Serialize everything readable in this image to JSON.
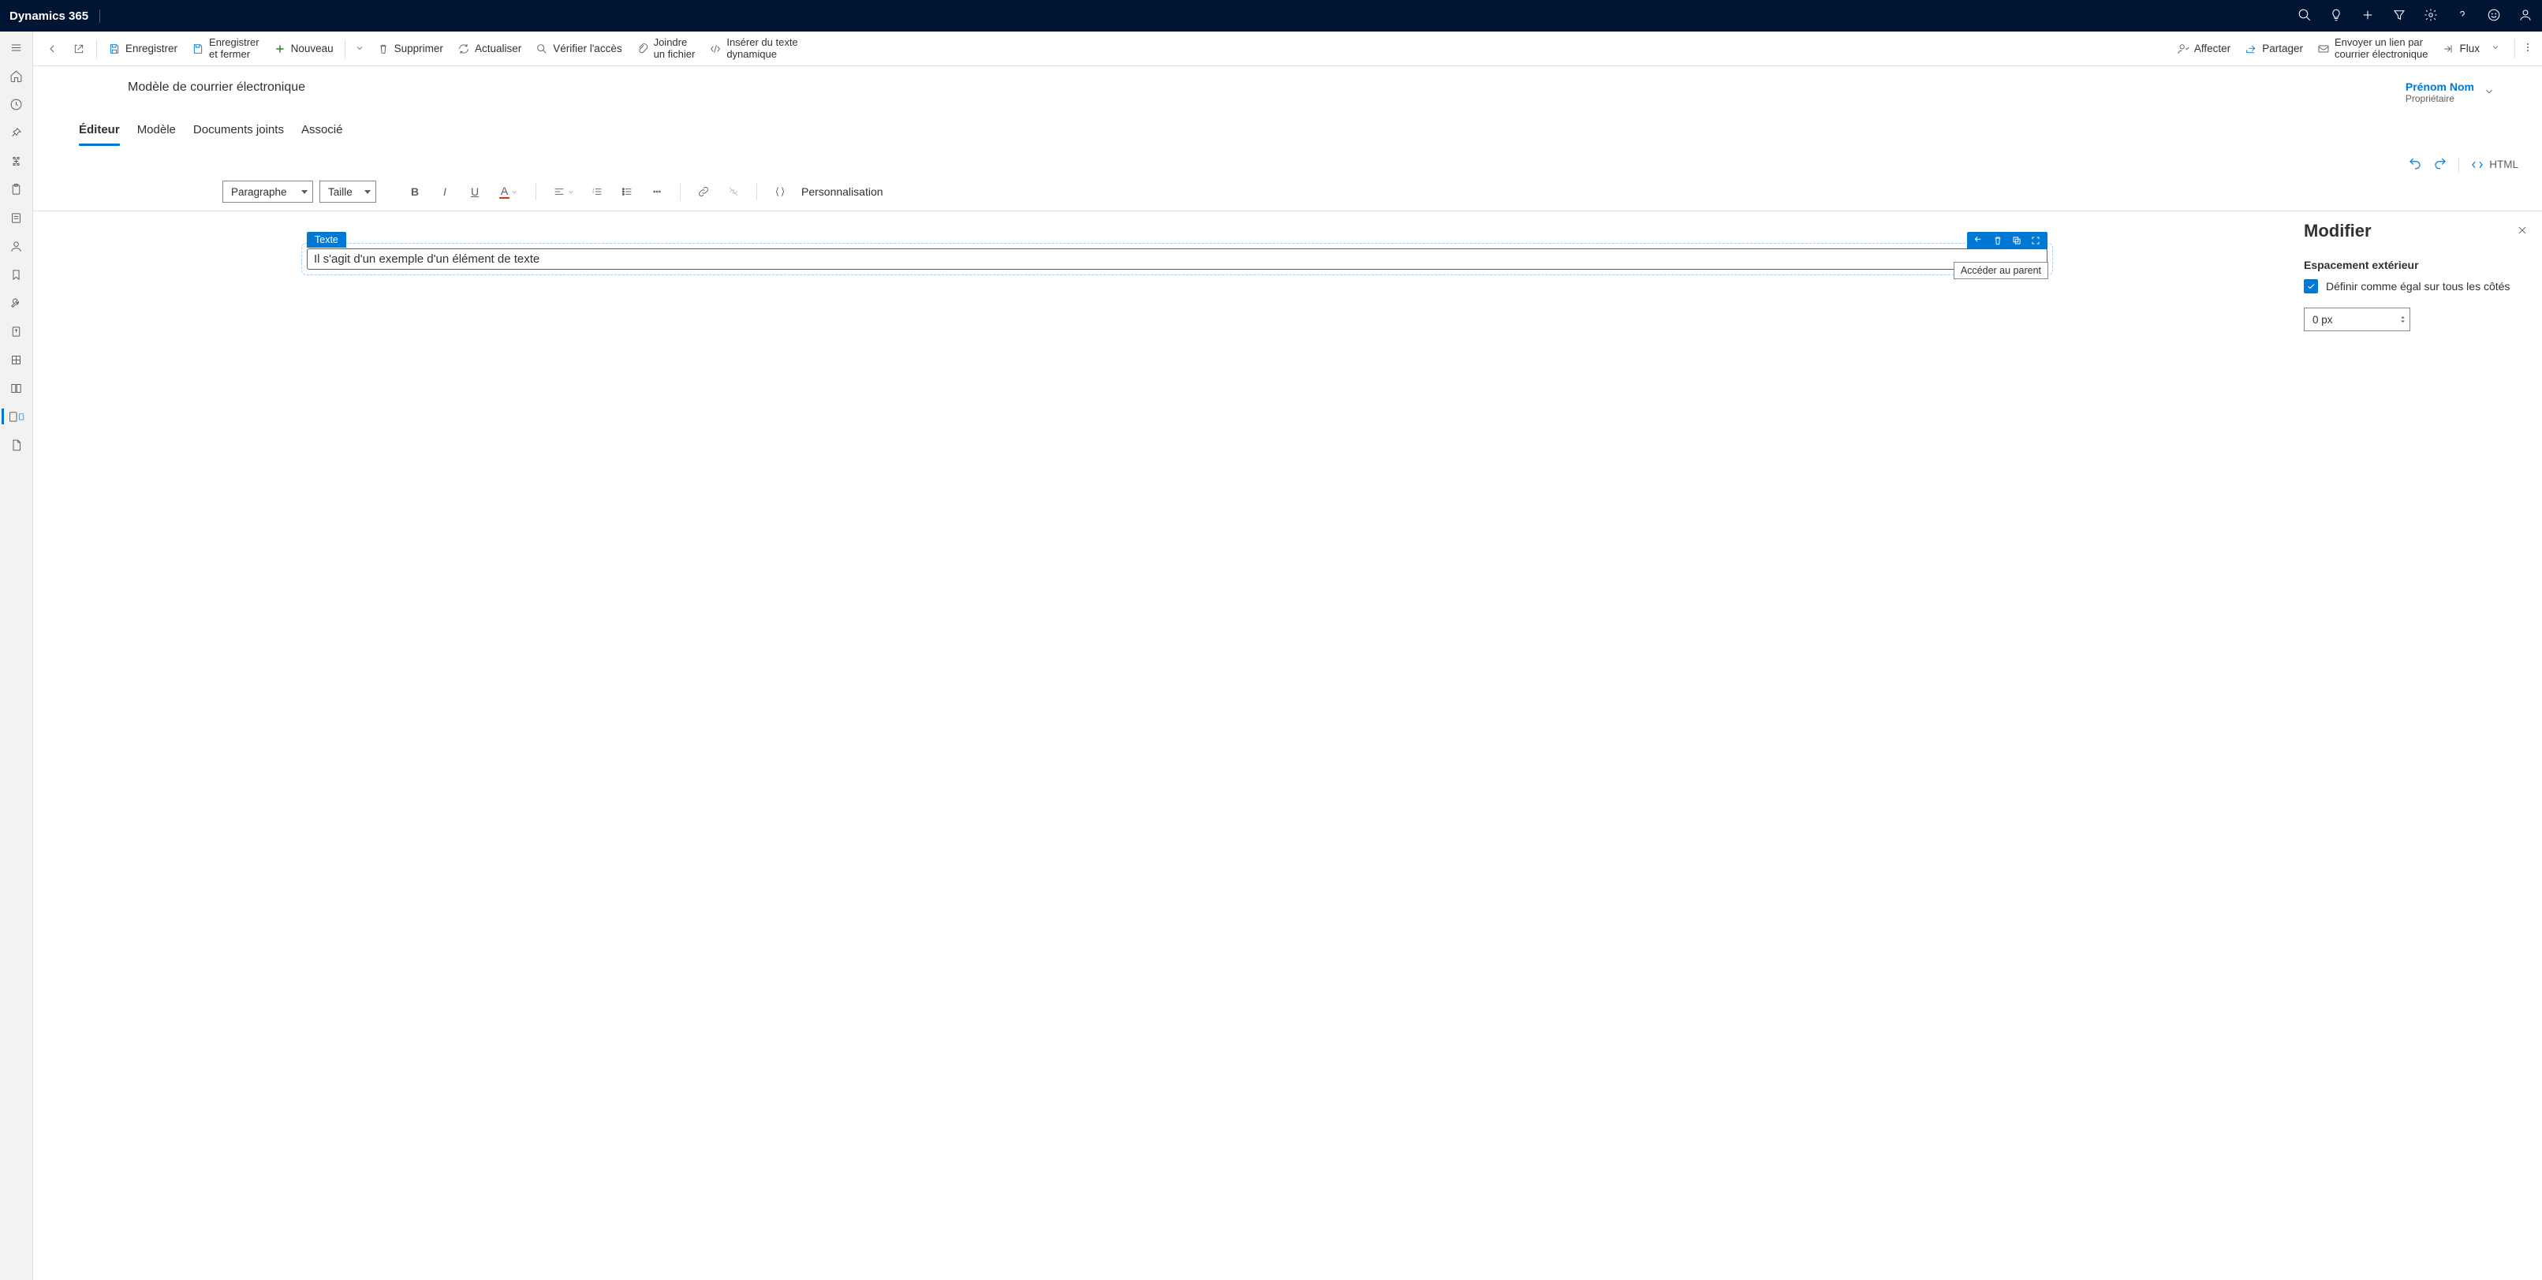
{
  "app": {
    "name": "Dynamics 365"
  },
  "commandBar": {
    "save": "Enregistrer",
    "saveClose": "Enregistrer\net fermer",
    "new": "Nouveau",
    "delete": "Supprimer",
    "refresh": "Actualiser",
    "checkAccess": "Vérifier l'accès",
    "attachFile": "Joindre\nun fichier",
    "insertDynamic": "Insérer du texte\ndynamique",
    "assign": "Affecter",
    "share": "Partager",
    "emailLink": "Envoyer un lien par\ncourrier électronique",
    "flow": "Flux"
  },
  "page": {
    "title": "Modèle de courrier électronique",
    "owner": {
      "name": "Prénom Nom",
      "label": "Propriétaire"
    }
  },
  "tabs": [
    "Éditeur",
    "Modèle",
    "Documents joints",
    "Associé"
  ],
  "editorTop": {
    "html": "HTML"
  },
  "toolbar": {
    "paragraph": "Paragraphe",
    "size": "Taille",
    "personalisation": "Personnalisation"
  },
  "canvas": {
    "elementLabel": "Texte",
    "textContent": "Il s'agit d'un exemple d'un élément de texte",
    "tooltip": "Accéder au parent"
  },
  "rightPanel": {
    "title": "Modifier",
    "spacingLabel": "Espacement extérieur",
    "checkboxLabel": "Définir comme égal sur tous les côtés",
    "spacingValue": "0 px"
  }
}
